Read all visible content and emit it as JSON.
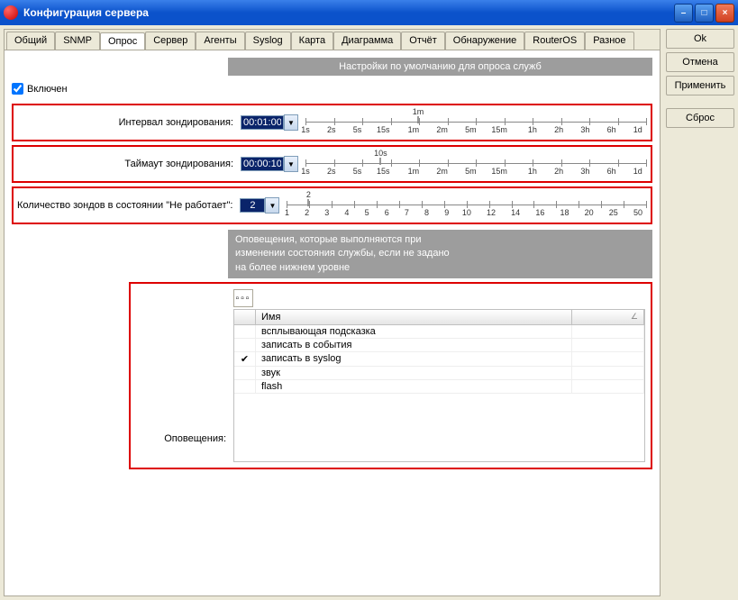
{
  "window": {
    "title": "Конфигурация сервера"
  },
  "tabs": {
    "general": "Общий",
    "snmp": "SNMP",
    "poll": "Опрос",
    "server": "Сервер",
    "agents": "Агенты",
    "syslog": "Syslog",
    "map": "Карта",
    "diagram": "Диаграмма",
    "report": "Отчёт",
    "discovery": "Обнаружение",
    "routeros": "RouterOS",
    "misc": "Разное"
  },
  "buttons": {
    "ok": "Ok",
    "cancel": "Отмена",
    "apply": "Применить",
    "reset": "Сброс"
  },
  "poll": {
    "banner1": "Настройки по умолчанию для опроса служб",
    "enabled_label": "Включен",
    "interval_label": "Интервал зондирования:",
    "interval_value": "00:01:00",
    "interval_display": "1m",
    "timeout_label": "Таймаут зондирования:",
    "timeout_value": "00:00:10",
    "timeout_display": "10s",
    "down_label": "Количество зондов в состоянии \"Не работает\":",
    "down_value": "2",
    "down_display": "2",
    "time_ticks": [
      "1s",
      "2s",
      "5s",
      "15s",
      "1m",
      "2m",
      "5m",
      "15m",
      "1h",
      "2h",
      "3h",
      "6h",
      "1d"
    ],
    "count_ticks": [
      "1",
      "2",
      "3",
      "4",
      "5",
      "6",
      "7",
      "8",
      "9",
      "10",
      "12",
      "14",
      "16",
      "18",
      "20",
      "25",
      "50"
    ],
    "banner2_l1": "Оповещения, которые выполняются при",
    "banner2_l2": "изменении состояния службы, если не задано",
    "banner2_l3": "на более нижнем уровне",
    "alerts_label": "Оповещения:",
    "grid_head_name": "Имя",
    "alerts": [
      {
        "checked": false,
        "name": "всплывающая подсказка"
      },
      {
        "checked": false,
        "name": "записать в события"
      },
      {
        "checked": true,
        "name": "записать в syslog"
      },
      {
        "checked": false,
        "name": "звук"
      },
      {
        "checked": false,
        "name": "flash"
      }
    ]
  }
}
